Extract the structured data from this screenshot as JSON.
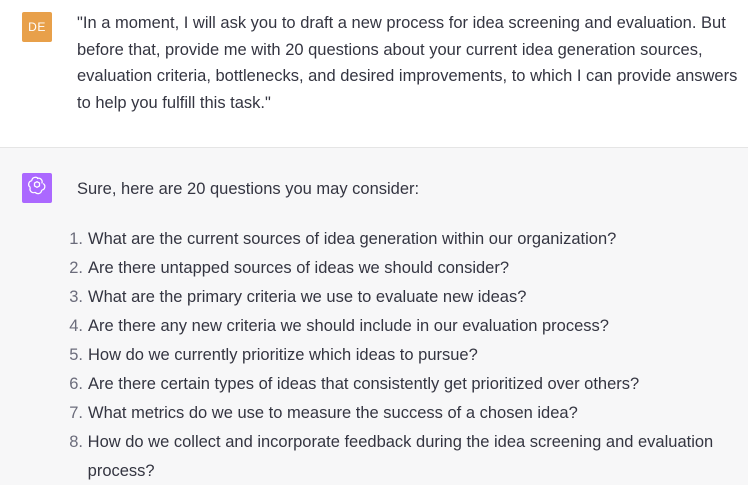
{
  "user": {
    "avatar_initials": "DE",
    "avatar_color": "#e8a04a",
    "message": "\"In a moment, I will ask you to draft a new process for idea screening and evaluation. But before that, provide me with 20 questions about your current idea generation sources, evaluation criteria, bottlenecks, and desired improvements, to which I can provide answers to help you fulfill this task.\""
  },
  "assistant": {
    "avatar_icon": "openai-logo-icon",
    "avatar_color": "#ab68ff",
    "intro": "Sure, here are 20 questions you may consider:",
    "questions": [
      {
        "num": "1.",
        "text": "What are the current sources of idea generation within our organization?"
      },
      {
        "num": "2.",
        "text": "Are there untapped sources of ideas we should consider?"
      },
      {
        "num": "3.",
        "text": "What are the primary criteria we use to evaluate new ideas?"
      },
      {
        "num": "4.",
        "text": "Are there any new criteria we should include in our evaluation process?"
      },
      {
        "num": "5.",
        "text": "How do we currently prioritize which ideas to pursue?"
      },
      {
        "num": "6.",
        "text": "Are there certain types of ideas that consistently get prioritized over others?"
      },
      {
        "num": "7.",
        "text": "What metrics do we use to measure the success of a chosen idea?"
      },
      {
        "num": "8.",
        "text": "How do we collect and incorporate feedback during the idea screening and evaluation process?"
      }
    ]
  }
}
